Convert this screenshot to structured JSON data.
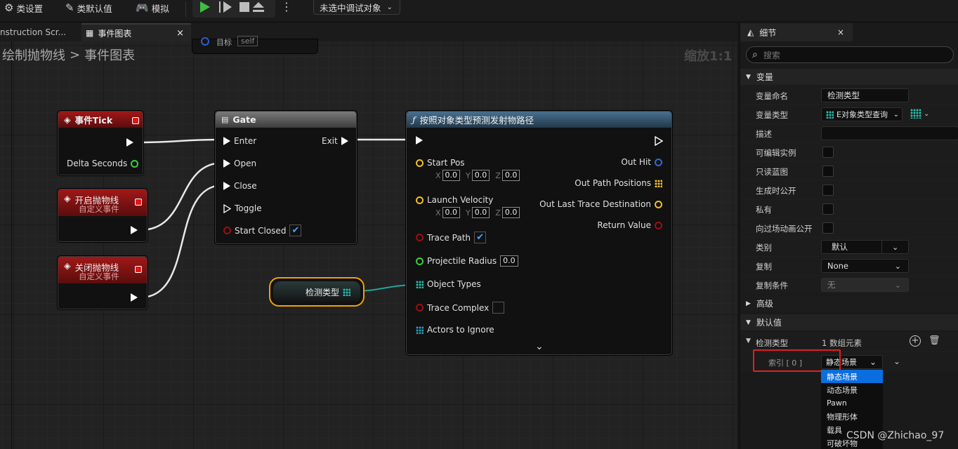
{
  "toolbar": {
    "class_settings": "类设置",
    "class_defaults": "类默认值",
    "simulate": "模拟",
    "debug_target": "未选中调试对象"
  },
  "tabs": [
    {
      "label": "nstruction Scr..."
    },
    {
      "label": "事件图表",
      "close": "×"
    }
  ],
  "breadcrumb": {
    "parent": "绘制抛物线",
    "separator": ">",
    "current": "事件图表"
  },
  "zoom_label": "缩放1:1",
  "partial_node": {
    "pin": "目标",
    "value": "self"
  },
  "nodes": {
    "tick": {
      "title": "事件Tick",
      "delta": "Delta Seconds"
    },
    "open_event": {
      "title": "开启抛物线",
      "subtitle": "自定义事件"
    },
    "close_event": {
      "title": "关闭抛物线",
      "subtitle": "自定义事件"
    },
    "gate": {
      "title": "Gate",
      "enter": "Enter",
      "exit": "Exit",
      "open": "Open",
      "close": "Close",
      "toggle": "Toggle",
      "start_closed": "Start Closed"
    },
    "variable": {
      "title": "检测类型"
    },
    "predict": {
      "title": "按照对象类型预测发射物路径",
      "start_pos": "Start Pos",
      "launch_velocity": "Launch Velocity",
      "trace_path": "Trace Path",
      "projectile_radius": "Projectile Radius",
      "projectile_radius_value": "0.0",
      "object_types": "Object Types",
      "trace_complex": "Trace Complex",
      "actors_to_ignore": "Actors to Ignore",
      "out_hit": "Out Hit",
      "out_path_positions": "Out Path Positions",
      "out_last_trace": "Out Last Trace Destination",
      "return_value": "Return Value",
      "x": "X",
      "y": "Y",
      "z": "Z",
      "zero": "0.0"
    }
  },
  "details": {
    "tab": "细节",
    "close": "×",
    "search_placeholder": "搜索",
    "section_variable": "变量",
    "rows": {
      "name_label": "变量命名",
      "name_value": "检测类型",
      "type_label": "变量类型",
      "type_value": "E对象类型查询",
      "desc_label": "描述",
      "editable_label": "可编辑实例",
      "readonly_label": "只读蓝图",
      "spawn_label": "生成时公开",
      "private_label": "私有",
      "cinematic_label": "向过场动画公开",
      "category_label": "类别",
      "category_value": "默认",
      "replication_label": "复制",
      "replication_value": "None",
      "repcond_label": "复制条件",
      "repcond_value": "无"
    },
    "section_advanced": "高级",
    "section_default": "默认值",
    "default_label": "检测类型",
    "array_count": "1 数组元素",
    "index_label": "索引 [ 0 ]",
    "index_value": "静态场景",
    "options": [
      "静态场景",
      "动态场景",
      "Pawn",
      "物理形体",
      "载具",
      "可破坏物"
    ]
  },
  "watermark": "CSDN @Zhichao_97",
  "colors": {
    "accent": "#0b6ee0",
    "highlight_box": "#e02020",
    "event_red": "#8a1414",
    "function_blue": "#2e5270"
  }
}
